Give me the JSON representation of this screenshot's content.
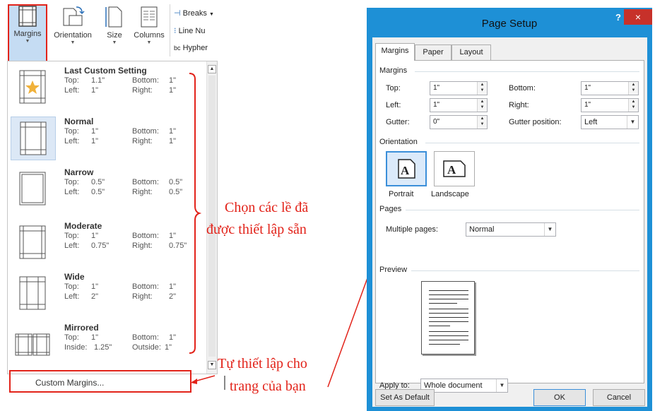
{
  "ribbon": {
    "margins_label": "Margins",
    "orientation_label": "Orientation",
    "size_label": "Size",
    "columns_label": "Columns",
    "breaks_label": "Breaks",
    "line_numbers_label": "Line Nu",
    "hyphenation_label": "Hypher"
  },
  "margins_menu": {
    "presets": [
      {
        "name": "Last Custom Setting",
        "k1": "Top:",
        "v1": "1.1\"",
        "k2": "Bottom:",
        "v2": "1\"",
        "k3": "Left:",
        "v3": "1\"",
        "k4": "Right:",
        "v4": "1\""
      },
      {
        "name": "Normal",
        "k1": "Top:",
        "v1": "1\"",
        "k2": "Bottom:",
        "v2": "1\"",
        "k3": "Left:",
        "v3": "1\"",
        "k4": "Right:",
        "v4": "1\""
      },
      {
        "name": "Narrow",
        "k1": "Top:",
        "v1": "0.5\"",
        "k2": "Bottom:",
        "v2": "0.5\"",
        "k3": "Left:",
        "v3": "0.5\"",
        "k4": "Right:",
        "v4": "0.5\""
      },
      {
        "name": "Moderate",
        "k1": "Top:",
        "v1": "1\"",
        "k2": "Bottom:",
        "v2": "1\"",
        "k3": "Left:",
        "v3": "0.75\"",
        "k4": "Right:",
        "v4": "0.75\""
      },
      {
        "name": "Wide",
        "k1": "Top:",
        "v1": "1\"",
        "k2": "Bottom:",
        "v2": "1\"",
        "k3": "Left:",
        "v3": "2\"",
        "k4": "Right:",
        "v4": "2\""
      },
      {
        "name": "Mirrored",
        "k1": "Top:",
        "v1": "1\"",
        "k2": "Bottom:",
        "v2": "1\"",
        "k3": "Inside:",
        "v3": "1.25\"",
        "k4": "Outside:",
        "v4": "1\""
      }
    ],
    "custom_margins_label": "Custom Margins..."
  },
  "annotations": {
    "preset_note_line1": "Chọn các lề đã",
    "preset_note_line2": "được thiết lập sẵn",
    "custom_note_line1": "Tự thiết lập cho",
    "custom_note_line2": "trang của bạn",
    "accent_color": "#e2231a"
  },
  "dialog": {
    "title": "Page Setup",
    "help": "?",
    "close": "×",
    "tabs": [
      "Margins",
      "Paper",
      "Layout"
    ],
    "margins_group": "Margins",
    "top_label": "Top:",
    "top_value": "1\"",
    "bottom_label": "Bottom:",
    "bottom_value": "1\"",
    "left_label": "Left:",
    "left_value": "1\"",
    "right_label": "Right:",
    "right_value": "1\"",
    "gutter_label": "Gutter:",
    "gutter_value": "0\"",
    "gutter_position_label": "Gutter position:",
    "gutter_position_value": "Left",
    "orientation_group": "Orientation",
    "portrait_label": "Portrait",
    "landscape_label": "Landscape",
    "pages_group": "Pages",
    "multiple_pages_label": "Multiple pages:",
    "multiple_pages_value": "Normal",
    "preview_group": "Preview",
    "apply_to_label": "Apply to:",
    "apply_to_value": "Whole document",
    "set_default_button": "Set As Default",
    "ok_button": "OK",
    "cancel_button": "Cancel",
    "title_bar_color": "#1e90d6"
  }
}
